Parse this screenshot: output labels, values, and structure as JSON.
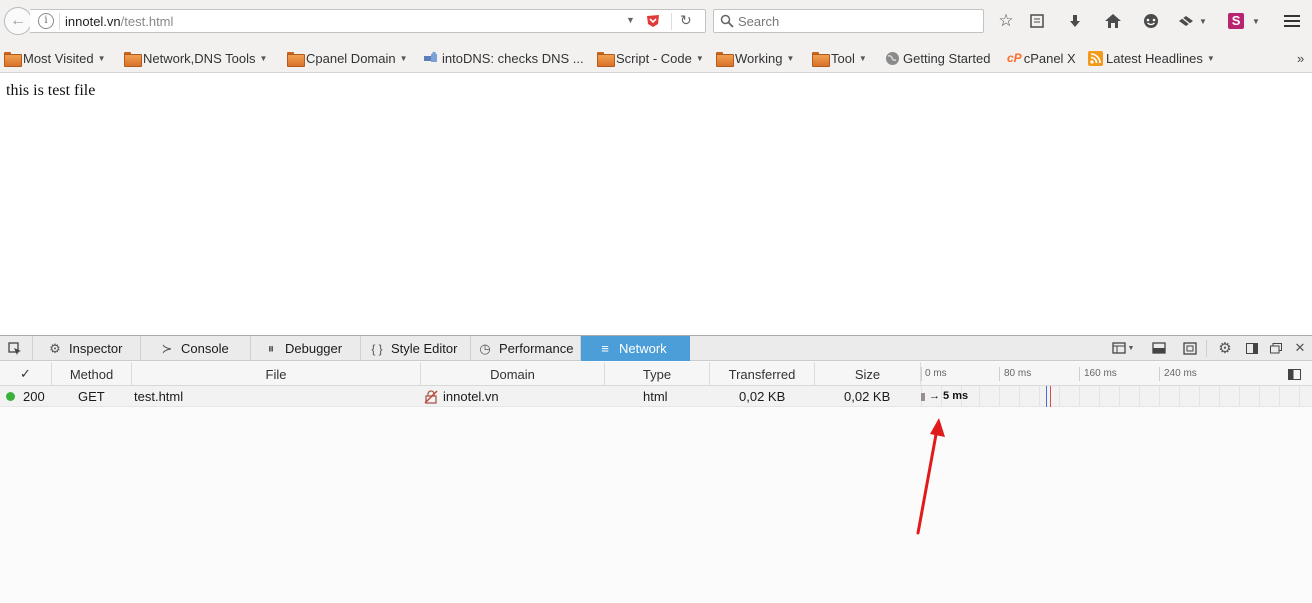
{
  "browser": {
    "url_host": "innotel.vn",
    "url_path": "/test.html",
    "search_placeholder": "Search"
  },
  "bookmarks": [
    {
      "label": "Most Visited",
      "icon": "folder-icon",
      "dropdown": true
    },
    {
      "label": "Network,DNS Tools",
      "icon": "folder-icon",
      "dropdown": true
    },
    {
      "label": "Cpanel Domain",
      "icon": "folder-icon",
      "dropdown": true
    },
    {
      "label": "intoDNS: checks DNS ...",
      "icon": "puzzle-icon",
      "dropdown": false
    },
    {
      "label": "Script - Code",
      "icon": "folder-icon",
      "dropdown": true
    },
    {
      "label": "Working",
      "icon": "folder-icon",
      "dropdown": true
    },
    {
      "label": "Tool",
      "icon": "folder-icon",
      "dropdown": true
    },
    {
      "label": "Getting Started",
      "icon": "globe-icon",
      "dropdown": false
    },
    {
      "label": "cPanel X",
      "icon": "cpanel-icon",
      "dropdown": false
    },
    {
      "label": "Latest Headlines",
      "icon": "rss-icon",
      "dropdown": true
    }
  ],
  "page": {
    "text": "this is test file"
  },
  "devtools": {
    "tabs": [
      {
        "label": "Inspector",
        "icon": "inspector-icon"
      },
      {
        "label": "Console",
        "icon": "console-icon"
      },
      {
        "label": "Debugger",
        "icon": "debugger-icon"
      },
      {
        "label": "Style Editor",
        "icon": "style-editor-icon"
      },
      {
        "label": "Performance",
        "icon": "performance-icon"
      },
      {
        "label": "Network",
        "icon": "network-icon",
        "active": true
      }
    ],
    "columns": {
      "status_check": "✓",
      "method": "Method",
      "file": "File",
      "domain": "Domain",
      "type": "Type",
      "transferred": "Transferred",
      "size": "Size"
    },
    "timeline_ticks": [
      "0 ms",
      "80 ms",
      "160 ms",
      "240 ms"
    ],
    "requests": [
      {
        "status": "200",
        "method": "GET",
        "file": "test.html",
        "domain": "innotel.vn",
        "type": "html",
        "transferred": "0,02 KB",
        "size": "0,02 KB",
        "timing": "→ 5 ms"
      }
    ]
  },
  "colors": {
    "active_tab": "#4c9ed9",
    "status_ok": "#3ab13a",
    "annotation_arrow": "#e01b1b"
  }
}
